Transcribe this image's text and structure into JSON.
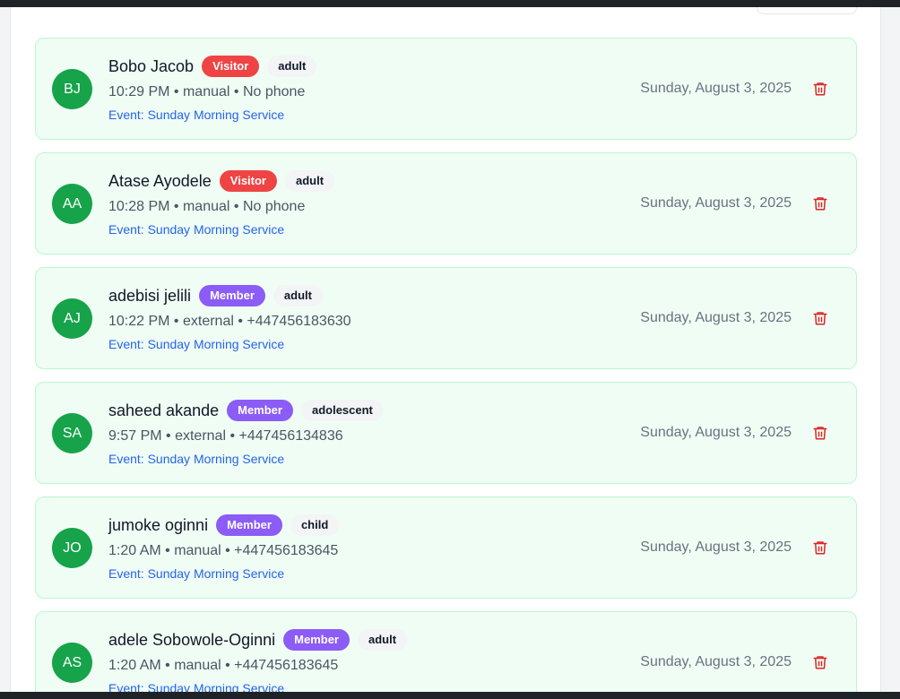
{
  "attendance": [
    {
      "initials": "BJ",
      "name": "Bobo Jacob",
      "status": "Visitor",
      "status_type": "visitor",
      "age_group": "adult",
      "meta": "10:29 PM • manual • No phone",
      "event": "Event: Sunday Morning Service",
      "date": "Sunday, August 3, 2025"
    },
    {
      "initials": "AA",
      "name": "Atase Ayodele",
      "status": "Visitor",
      "status_type": "visitor",
      "age_group": "adult",
      "meta": "10:28 PM • manual • No phone",
      "event": "Event: Sunday Morning Service",
      "date": "Sunday, August 3, 2025"
    },
    {
      "initials": "AJ",
      "name": "adebisi jelili",
      "status": "Member",
      "status_type": "member",
      "age_group": "adult",
      "meta": "10:22 PM • external • +447456183630",
      "event": "Event: Sunday Morning Service",
      "date": "Sunday, August 3, 2025"
    },
    {
      "initials": "SA",
      "name": "saheed akande",
      "status": "Member",
      "status_type": "member",
      "age_group": "adolescent",
      "meta": "9:57 PM • external • +447456134836",
      "event": "Event: Sunday Morning Service",
      "date": "Sunday, August 3, 2025"
    },
    {
      "initials": "JO",
      "name": "jumoke oginni",
      "status": "Member",
      "status_type": "member",
      "age_group": "child",
      "meta": "1:20 AM • manual • +447456183645",
      "event": "Event: Sunday Morning Service",
      "date": "Sunday, August 3, 2025"
    },
    {
      "initials": "AS",
      "name": "adele Sobowole-Oginni",
      "status": "Member",
      "status_type": "member",
      "age_group": "adult",
      "meta": "1:20 AM • manual • +447456183645",
      "event": "Event: Sunday Morning Service",
      "date": "Sunday, August 3, 2025"
    }
  ],
  "colors": {
    "card_bg": "#f0fdf4",
    "card_border": "#bbf7d0",
    "avatar": "#16a34a",
    "visitor_badge": "#ef4444",
    "member_badge": "#8b5cf6",
    "event_link": "#2563eb",
    "delete_icon": "#dc2626"
  },
  "icons": {
    "delete": "trash-icon"
  }
}
